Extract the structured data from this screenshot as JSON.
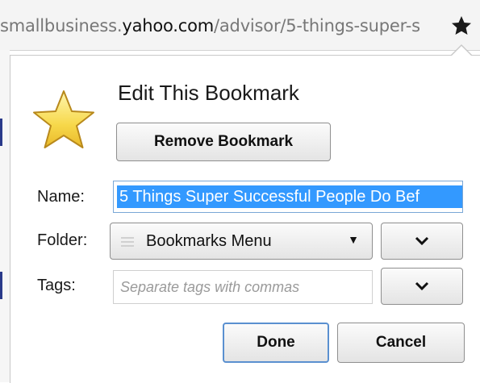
{
  "urlbar": {
    "url_prefix": "smallbusiness.",
    "url_domain": "yahoo.com",
    "url_path": "/advisor/5-things-super-s",
    "bookmark_icon": "star-filled-icon"
  },
  "panel": {
    "title": "Edit This Bookmark",
    "icon": "star-icon",
    "remove_button": "Remove Bookmark",
    "name_label": "Name:",
    "name_value": "5 Things Super Successful People Do Bef",
    "folder_label": "Folder:",
    "folder_value": "Bookmarks Menu",
    "tags_label": "Tags:",
    "tags_placeholder": "Separate tags with commas",
    "done_button": "Done",
    "cancel_button": "Cancel"
  }
}
